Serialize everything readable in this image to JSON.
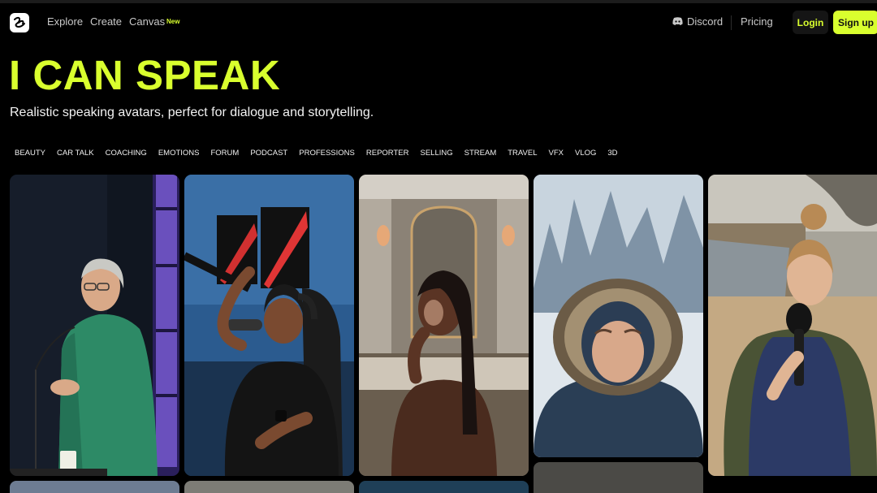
{
  "nav": {
    "links": [
      "Explore",
      "Create",
      "Canvas"
    ],
    "canvas_badge": "New",
    "discord": "Discord",
    "pricing": "Pricing",
    "login": "Login",
    "signup": "Sign up"
  },
  "hero": {
    "title": "I CAN SPEAK",
    "subtitle": "Realistic speaking avatars, perfect for dialogue and storytelling."
  },
  "categories": [
    "BEAUTY",
    "CAR TALK",
    "COACHING",
    "EMOTIONS",
    "FORUM",
    "PODCAST",
    "PROFESSIONS",
    "REPORTER",
    "SELLING",
    "STREAM",
    "TRAVEL",
    "VFX",
    "VLOG",
    "3D"
  ],
  "gallery": [
    {
      "subject": "woman-speaker-at-podium",
      "palette": [
        "#1a2130",
        "#2f8a63"
      ]
    },
    {
      "subject": "podcaster-with-microphone",
      "palette": [
        "#2d5f93",
        "#151515"
      ]
    },
    {
      "subject": "woman-in-bathroom",
      "palette": [
        "#8a8070",
        "#4a2a1c"
      ]
    },
    {
      "subject": "man-in-snow-parka",
      "palette": [
        "#b9c8d6",
        "#2e4560"
      ]
    },
    {
      "subject": "reporter-in-vest",
      "palette": [
        "#9fa6ab",
        "#2a3555"
      ]
    }
  ],
  "colors": {
    "accent": "#d9ff2e",
    "background": "#000000",
    "nav_text": "#c9c9c9"
  }
}
